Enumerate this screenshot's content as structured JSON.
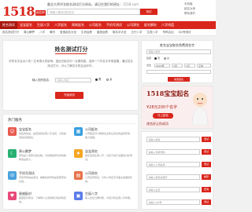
{
  "header": {
    "logo_number": "1518",
    "logo_badge": "起名网",
    "slogan": "最全大师评名取名测试打分网站，请记住我们的网址：",
    "domain": "1518.com",
    "search_placeholder": "请输入要测试的名字",
    "search_button": "测试",
    "links": [
      "手机版",
      "起名大师",
      "联系我们"
    ]
  },
  "nav_primary": [
    "姓名测试",
    "宝宝起名",
    "生辰八字",
    "八字起名",
    "周易起名",
    "公司起名",
    "手机号测试",
    "公司测名",
    "起名解析",
    "八字排盘",
    "诗词起名",
    "更多"
  ],
  "nav_secondary": [
    "姓名测试打分",
    "周公解梦",
    "八字",
    "黄历",
    "宝宝起名大全",
    "生肖运势",
    "星座运势",
    "取名字大全",
    "五行八字",
    "生辰八字",
    "号码吉凶",
    "QQ号测试",
    "八字合婚"
  ],
  "main": {
    "title": "姓名测试打分",
    "desc": "好的名字会对人的一生有很大的影响，因此在取名时一定要慎重，选择一个好名字非常重要。通过姓名测试打分，可以了解名字的吉凶好坏。",
    "name_label": "输入您的姓名：",
    "name_placeholder": "请输入姓名",
    "gender_male": "男",
    "gender_female": "女",
    "submit_label": "开始测试"
  },
  "services": {
    "title": "热门服务",
    "items": [
      {
        "name": "宝宝起名",
        "desc": "姓名的吉凶，由宝宝的生辰八字决定，为您提供最好的起名。",
        "icon": "baby-icon",
        "color": "#e85a4f"
      },
      {
        "name": "公司起名",
        "desc": "公司起名可以帮助企业树立良好的品牌形象，助力发展。",
        "icon": "building-icon",
        "color": "#3aa0e0"
      },
      {
        "name": "周公解梦",
        "desc": "梦境是人潜意识的反映，为您解答梦境中的各种吉凶含义。",
        "icon": "moon-icon",
        "color": "#27b072"
      },
      {
        "name": "宝宝测名",
        "desc": "结合宝宝生辰八字，对名字进行全面的分析测试。",
        "icon": "star-icon",
        "color": "#f5a623"
      },
      {
        "name": "手机号测试",
        "desc": "手机号码吉凶测试，看看您的号码是否能带来好运。",
        "icon": "phone-icon",
        "color": "#4aa3df"
      },
      {
        "name": "公司测名",
        "desc": "公司名称测试，分析公司名字对事业发展的影响。",
        "icon": "chart-icon",
        "color": "#e8734a"
      },
      {
        "name": "星座配对",
        "desc": "星座配对测试，了解两人之间的缘分和感情走向。",
        "icon": "heart-icon",
        "color": "#e84a7b"
      },
      {
        "name": "生辰八字",
        "desc": "输入出生日期时辰，为您分析生辰八字命理。",
        "icon": "calendar-icon",
        "color": "#5a7be8"
      }
    ]
  },
  "side_form": {
    "title": "姓名宝宝取名免费测名字",
    "surname_placeholder": "请输入姓氏",
    "gender_label": "性别",
    "gender_male": "男",
    "gender_female": "女",
    "birth_label": "出生",
    "year": "2023年",
    "month": "1月",
    "day": "1日",
    "hour": "子时",
    "submit_label": "免费起名"
  },
  "banner": {
    "title": "1518宝宝起名",
    "price": "¥28元200个名字",
    "button": "马上起名",
    "slogan": "改名好让你成功"
  },
  "side2": {
    "rows": [
      {
        "placeholder": "请输入姓名",
        "button": "测试"
      },
      {
        "placeholder": "请输入手机号码",
        "button": "测试"
      },
      {
        "placeholder": "请输入公司名称",
        "button": "测试"
      },
      {
        "placeholder": "请输入梦境关键字",
        "button": "解梦"
      },
      {
        "placeholder": "请输入生日",
        "button": "查询"
      },
      {
        "placeholder": "请输入QQ号",
        "button": "测试"
      }
    ]
  }
}
